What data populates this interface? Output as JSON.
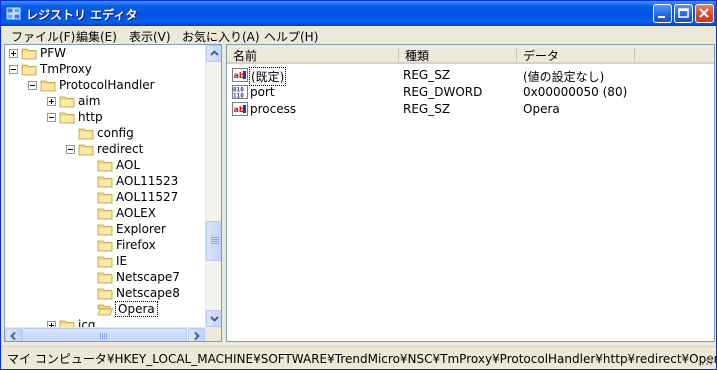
{
  "window": {
    "title": "レジストリ エディタ"
  },
  "menu": [
    {
      "label": "ファイル(F)"
    },
    {
      "label": "編集(E)"
    },
    {
      "label": "表示(V)"
    },
    {
      "label": "お気に入り(A)"
    },
    {
      "label": "ヘルプ(H)"
    }
  ],
  "tree": [
    {
      "label": "PFW",
      "expander": "plus"
    },
    {
      "label": "TmProxy",
      "expander": "minus"
    },
    {
      "label": "ProtocolHandler",
      "expander": "minus"
    },
    {
      "label": "aim",
      "expander": "plus"
    },
    {
      "label": "http",
      "expander": "minus"
    },
    {
      "label": "config",
      "expander": "none"
    },
    {
      "label": "redirect",
      "expander": "minus"
    },
    {
      "label": "AOL",
      "expander": "none"
    },
    {
      "label": "AOL11523",
      "expander": "none"
    },
    {
      "label": "AOL11527",
      "expander": "none"
    },
    {
      "label": "AOLEX",
      "expander": "none"
    },
    {
      "label": "Explorer",
      "expander": "none"
    },
    {
      "label": "Firefox",
      "expander": "none"
    },
    {
      "label": "IE",
      "expander": "none"
    },
    {
      "label": "Netscape7",
      "expander": "none"
    },
    {
      "label": "Netscape8",
      "expander": "none"
    },
    {
      "label": "Opera",
      "expander": "none",
      "selected": true,
      "open": true
    },
    {
      "label": "icq",
      "expander": "plus"
    }
  ],
  "list": {
    "columns": [
      "名前",
      "種類",
      "データ"
    ],
    "rows": [
      {
        "icon": "string-value-icon",
        "name": "(既定)",
        "type": "REG_SZ",
        "data": "(値の設定なし)"
      },
      {
        "icon": "binary-value-icon",
        "name": "port",
        "type": "REG_DWORD",
        "data": "0x00000050 (80)"
      },
      {
        "icon": "string-value-icon",
        "name": "process",
        "type": "REG_SZ",
        "data": "Opera"
      }
    ]
  },
  "status": {
    "path": "マイ コンピュータ¥HKEY_LOCAL_MACHINE¥SOFTWARE¥TrendMicro¥NSC¥TmProxy¥ProtocolHandler¥http¥redirect¥Opera"
  }
}
